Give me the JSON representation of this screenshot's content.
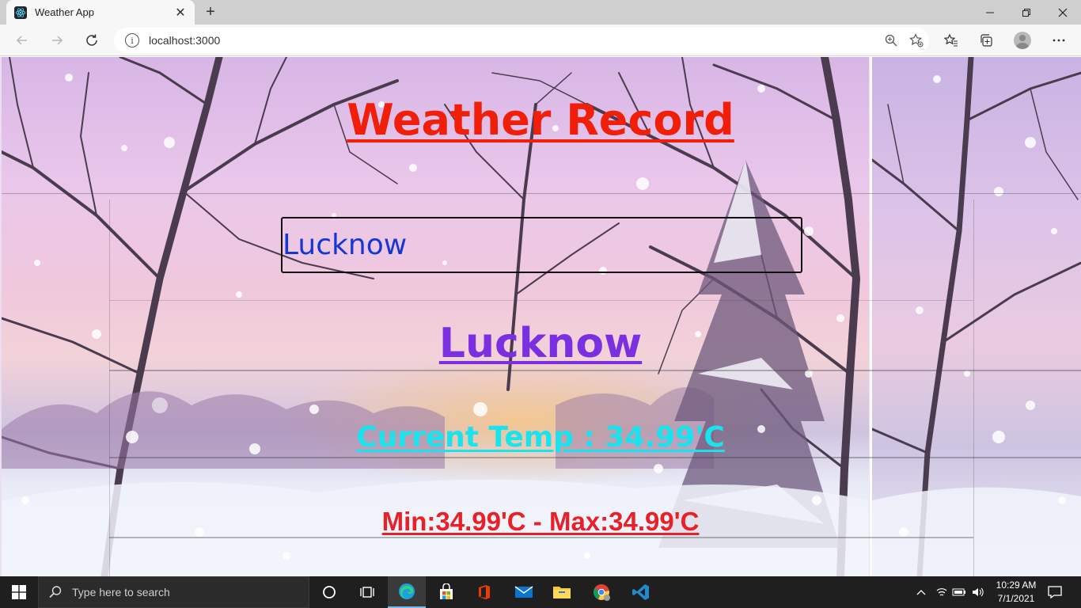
{
  "browser": {
    "tab": {
      "title": "Weather App"
    },
    "address": {
      "url": "localhost:3000"
    }
  },
  "app": {
    "title": "Weather Record",
    "search": {
      "value": "Lucknow"
    },
    "city": "Lucknow",
    "current_temp": "Current Temp : 34.99'C",
    "min_max": "Min:34.99'C - Max:34.99'C"
  },
  "taskbar": {
    "search_placeholder": "Type here to search",
    "time": "10:29 AM",
    "date": "7/1/2021"
  },
  "colors": {
    "title": "#f01f0a",
    "input_text": "#1537d6",
    "city": "#7a2fe0",
    "current_temp": "#19e3ee",
    "min_max": "#e8202a"
  }
}
